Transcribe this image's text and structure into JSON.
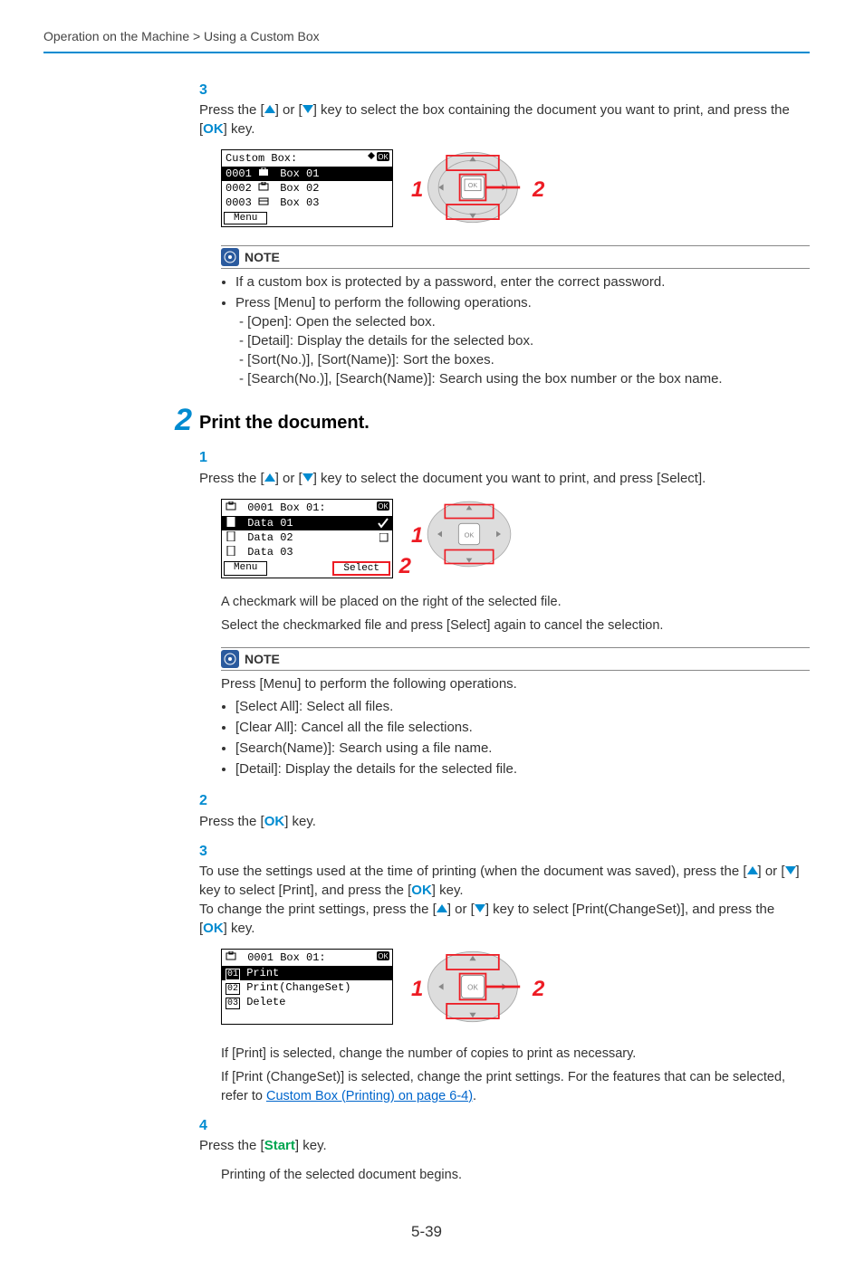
{
  "breadcrumb": "Operation on the Machine > Using a Custom Box",
  "step1": {
    "sub3": {
      "num": "3",
      "text_a": "Press the [",
      "text_b": "] or [",
      "text_c": "] key to select the box containing the document you want to print, and press the [",
      "ok": "OK",
      "text_d": "] key."
    },
    "lcd": {
      "title": "Custom Box:",
      "row1": "Box 01",
      "row2": "Box 02",
      "row3": "Box 03",
      "n1": "0001",
      "n2": "0002",
      "n3": "0003",
      "menu": "Menu"
    },
    "callouts": {
      "c1": "1",
      "c2": "2"
    },
    "note": {
      "head": "NOTE",
      "b1": "If a custom box is protected by a password, enter the correct password.",
      "b2": "Press [Menu] to perform the following operations.",
      "d1": "- [Open]: Open the selected box.",
      "d2": "- [Detail]: Display the details for the selected box.",
      "d3": "- [Sort(No.)], [Sort(Name)]: Sort the boxes.",
      "d4": "- [Search(No.)], [Search(Name)]: Search using the box number or the box name."
    }
  },
  "step2": {
    "bignum": "2",
    "title": "Print the document.",
    "sub1": {
      "num": "1",
      "text_a": "Press the [",
      "text_b": "] or [",
      "text_c": "] key to select the document you want to print, and press [Select]."
    },
    "lcd1": {
      "title": "0001 Box 01:",
      "row1": "Data 01",
      "row2": "Data 02",
      "row3": "Data 03",
      "menu": "Menu",
      "select": "Select"
    },
    "callouts1": {
      "c1": "1",
      "c2": "2"
    },
    "aftersel_p1": "A checkmark will be placed on the right of the selected file.",
    "aftersel_p2": "Select the checkmarked file and press [Select] again to cancel the selection.",
    "note1": {
      "head": "NOTE",
      "lead": "Press [Menu] to perform the following operations.",
      "b1": "[Select All]: Select all files.",
      "b2": "[Clear All]: Cancel all the file selections.",
      "b3": "[Search(Name)]: Search using a file name.",
      "b4": "[Detail]: Display the details for the selected file."
    },
    "sub2": {
      "num": "2",
      "text_a": "Press the [",
      "ok": "OK",
      "text_b": "] key."
    },
    "sub3": {
      "num": "3",
      "text_a": "To use the settings used at the time of printing (when the document was saved), press the [",
      "text_b": "] or [",
      "text_c": "] key to select [Print], and press the [",
      "ok1": "OK",
      "text_d": "] key.",
      "text_e": "To change the print settings, press the [",
      "text_f": "] or [",
      "text_g": "] key to select [Print(ChangeSet)], and press the [",
      "ok2": "OK",
      "text_h": "] key."
    },
    "lcd2": {
      "title": "0001 Box 01:",
      "r1n": "01",
      "r1": "Print",
      "r2n": "02",
      "r2": "Print(ChangeSet)",
      "r3n": "03",
      "r3": "Delete"
    },
    "callouts2": {
      "c1": "1",
      "c2": "2"
    },
    "p_printsel": "If [Print] is selected, change the number of copies to print as necessary.",
    "p_changeset_a": "If [Print (ChangeSet)] is selected, change the print settings. For the features that can be selected, refer to ",
    "xref": "Custom Box (Printing) on page 6-4)",
    "p_changeset_b": ".",
    "sub4": {
      "num": "4",
      "text_a": "Press the [",
      "start": "Start",
      "text_b": "] key."
    },
    "p_final": "Printing of the selected document begins."
  },
  "pagenum": "5-39"
}
